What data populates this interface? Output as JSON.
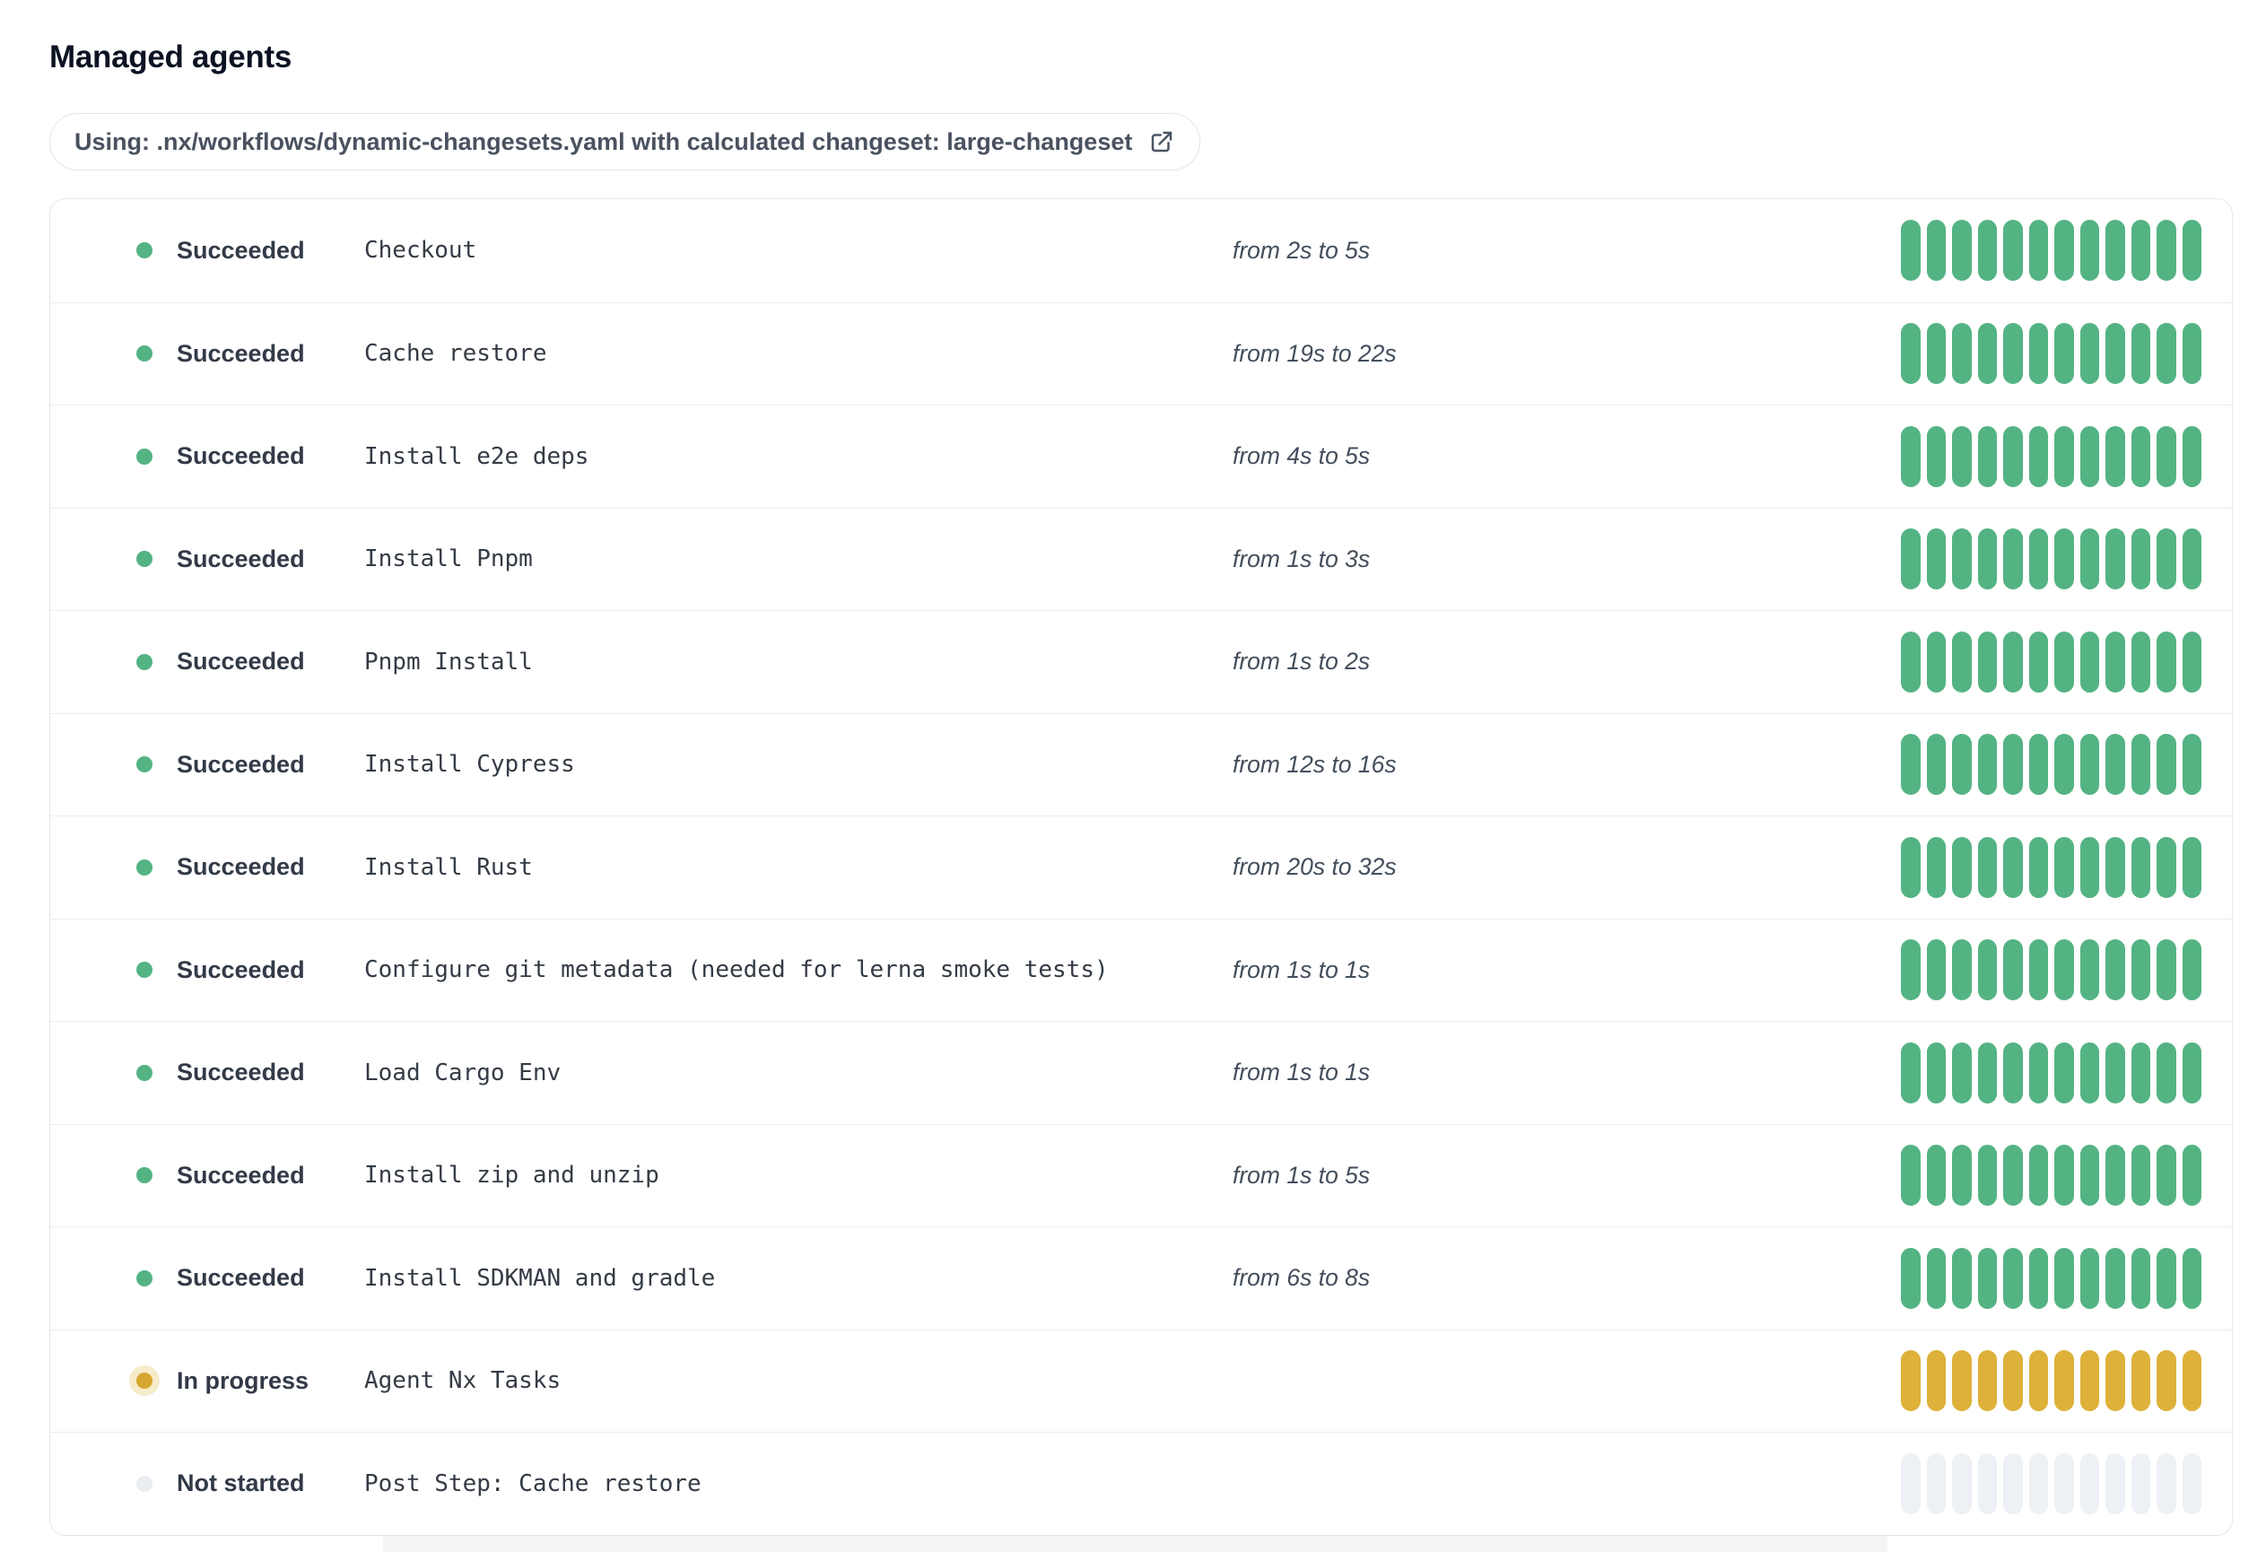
{
  "page": {
    "title": "Managed agents"
  },
  "workflow_banner": {
    "text": "Using: .nx/workflows/dynamic-changesets.yaml with calculated changeset: large-changeset",
    "icon": "external-link-icon"
  },
  "colors": {
    "succeeded": "#54b383",
    "in_progress": "#ddb13a",
    "in_progress_dot": "#d6a72e",
    "in_progress_halo": "#f6ecca",
    "not_started": "#edf1f5",
    "not_started_dot": "#e9eef3"
  },
  "agents": {
    "segments_per_bar": 12,
    "rows": [
      {
        "status": "Succeeded",
        "status_key": "succeeded",
        "step": "Checkout",
        "duration": "from 2s to 5s"
      },
      {
        "status": "Succeeded",
        "status_key": "succeeded",
        "step": "Cache restore",
        "duration": "from 19s to 22s"
      },
      {
        "status": "Succeeded",
        "status_key": "succeeded",
        "step": "Install e2e deps",
        "duration": "from 4s to 5s"
      },
      {
        "status": "Succeeded",
        "status_key": "succeeded",
        "step": "Install Pnpm",
        "duration": "from 1s to 3s"
      },
      {
        "status": "Succeeded",
        "status_key": "succeeded",
        "step": "Pnpm Install",
        "duration": "from 1s to 2s"
      },
      {
        "status": "Succeeded",
        "status_key": "succeeded",
        "step": "Install Cypress",
        "duration": "from 12s to 16s"
      },
      {
        "status": "Succeeded",
        "status_key": "succeeded",
        "step": "Install Rust",
        "duration": "from 20s to 32s"
      },
      {
        "status": "Succeeded",
        "status_key": "succeeded",
        "step": "Configure git metadata (needed for lerna smoke tests)",
        "duration": "from 1s to 1s"
      },
      {
        "status": "Succeeded",
        "status_key": "succeeded",
        "step": "Load Cargo Env",
        "duration": "from 1s to 1s"
      },
      {
        "status": "Succeeded",
        "status_key": "succeeded",
        "step": "Install zip and unzip",
        "duration": "from 1s to 5s"
      },
      {
        "status": "Succeeded",
        "status_key": "succeeded",
        "step": "Install SDKMAN and gradle",
        "duration": "from 6s to 8s"
      },
      {
        "status": "In progress",
        "status_key": "in_progress",
        "step": "Agent Nx Tasks",
        "duration": ""
      },
      {
        "status": "Not started",
        "status_key": "not_started",
        "step": "Post Step: Cache restore",
        "duration": ""
      }
    ]
  }
}
